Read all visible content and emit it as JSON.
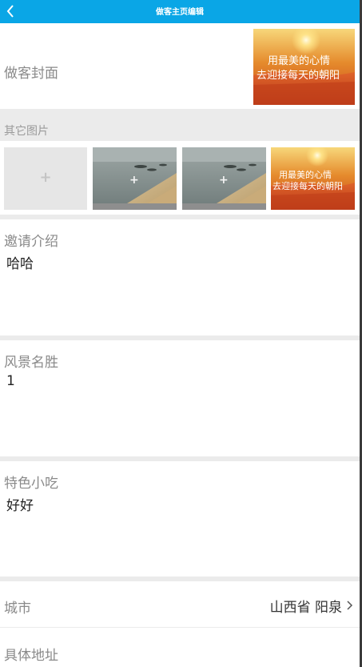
{
  "header": {
    "title": "做客主页编辑",
    "back_icon": "chevron-left-icon"
  },
  "cover": {
    "label": "做客封面",
    "image_caption_line1": "用最美的心情",
    "image_caption_line2": "去迎接每天的朝阳"
  },
  "other_images": {
    "label": "其它图片",
    "add_symbol": "+",
    "thumbs": [
      {
        "type": "lakeside"
      },
      {
        "type": "lakeside"
      },
      {
        "type": "sunset",
        "caption_line1": "用最美的心情",
        "caption_line2": "去迎接每天的朝阳"
      }
    ]
  },
  "invitation": {
    "label": "邀请介绍",
    "value": "哈哈"
  },
  "scenery": {
    "label": "风景名胜",
    "value": "1"
  },
  "snacks": {
    "label": "特色小吃",
    "value": "好好"
  },
  "city": {
    "label": "城市",
    "value": "山西省 阳泉"
  },
  "address": {
    "label": "具体地址"
  },
  "colors": {
    "header_bg": "#0aa6e6",
    "separator": "#ebebeb",
    "label_gray": "#8a8a8a"
  }
}
